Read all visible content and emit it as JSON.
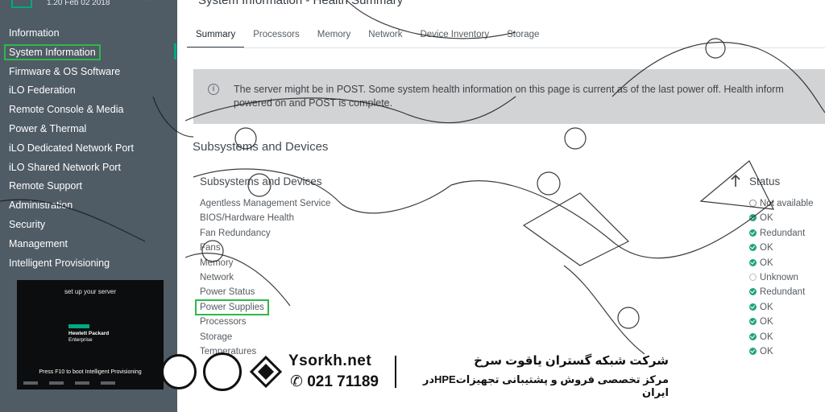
{
  "header": {
    "fw_version": "1.20 Feb 02 2018"
  },
  "sidebar": {
    "items": [
      {
        "label": "Information"
      },
      {
        "label": "System Information",
        "active": true
      },
      {
        "label": "Firmware & OS Software"
      },
      {
        "label": "iLO Federation"
      },
      {
        "label": "Remote Console & Media"
      },
      {
        "label": "Power & Thermal"
      },
      {
        "label": "iLO Dedicated Network Port"
      },
      {
        "label": "iLO Shared Network Port"
      },
      {
        "label": "Remote Support"
      },
      {
        "label": "Administration"
      },
      {
        "label": "Security"
      },
      {
        "label": "Management"
      },
      {
        "label": "Intelligent Provisioning"
      }
    ],
    "banner": {
      "title": "set up your server",
      "brand_line1": "Hewlett Packard",
      "brand_line2": "Enterprise",
      "cta": "Press F10 to boot Intelligent Provisioning"
    }
  },
  "main": {
    "page_title": "System Information - Health Summary",
    "tabs": [
      {
        "label": "Summary",
        "active": true
      },
      {
        "label": "Processors"
      },
      {
        "label": "Memory"
      },
      {
        "label": "Network"
      },
      {
        "label": "Device Inventory"
      },
      {
        "label": "Storage"
      }
    ],
    "notice": {
      "icon": "info-icon",
      "line1": "The server might be in POST. Some system health information on this page is current as of the last power off. Health inform",
      "line2": "powered on and POST is complete."
    },
    "section_heading": "Subsystems and Devices",
    "table": {
      "col_name": "Subsystems and Devices",
      "col_status": "Status",
      "rows": [
        {
          "name": "Agentless Management Service",
          "status": "Not available",
          "state": "na"
        },
        {
          "name": "BIOS/Hardware Health",
          "status": "OK",
          "state": "ok"
        },
        {
          "name": "Fan Redundancy",
          "status": "Redundant",
          "state": "ok"
        },
        {
          "name": "Fans",
          "status": "OK",
          "state": "ok"
        },
        {
          "name": "Memory",
          "status": "OK",
          "state": "ok"
        },
        {
          "name": "Network",
          "status": "Unknown",
          "state": "unk"
        },
        {
          "name": "Power Status",
          "status": "Redundant",
          "state": "ok"
        },
        {
          "name": "Power Supplies",
          "status": "OK",
          "state": "ok",
          "highlight": true
        },
        {
          "name": "Processors",
          "status": "OK",
          "state": "ok"
        },
        {
          "name": "Storage",
          "status": "OK",
          "state": "ok"
        },
        {
          "name": "Temperatures",
          "status": "OK",
          "state": "ok"
        }
      ]
    }
  },
  "watermark": {
    "site": "Ysorkh.net",
    "phone": "021 71189",
    "company_fa": "شرکت شبکه گستران یاقوت سرخ",
    "tagline_fa": "مرکز تخصصی فروش و پشتیبانی تجهیزاتHPEدر ایران"
  },
  "colors": {
    "accent": "#01a982",
    "status_ok": "#1fa37c",
    "highlight_box": "#2db94a",
    "sidebar_bg": "#4f5b65"
  }
}
